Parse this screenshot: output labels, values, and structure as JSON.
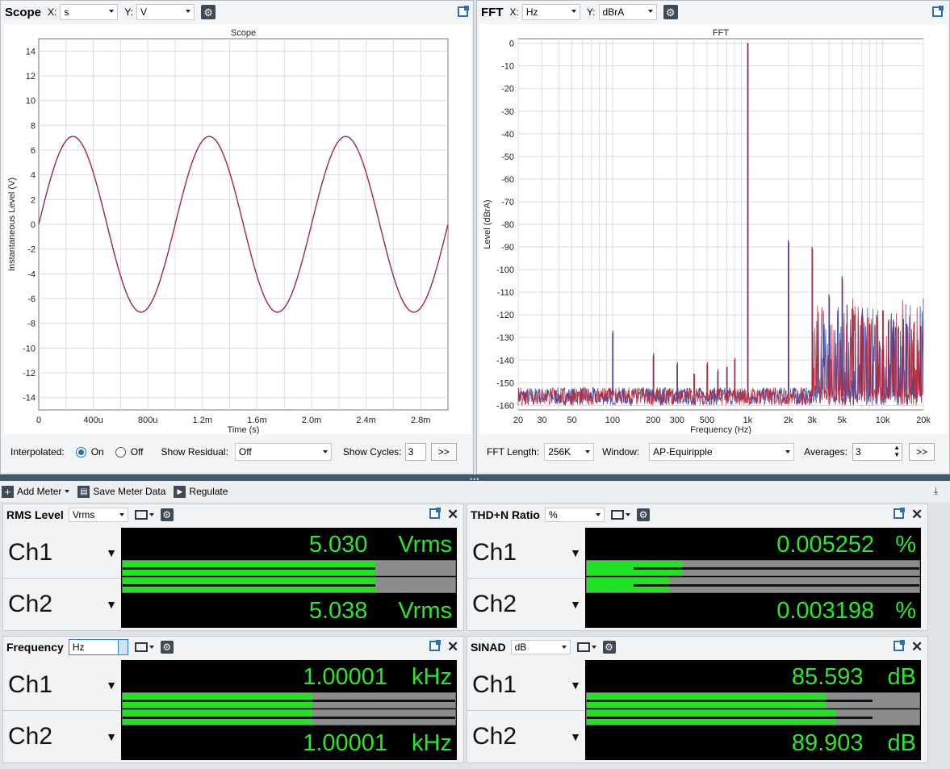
{
  "scope": {
    "title": "Scope",
    "x_label": "X:",
    "x_unit": "s",
    "y_label": "Y:",
    "y_unit": "V",
    "interpolated_label": "Interpolated:",
    "on_label": "On",
    "off_label": "Off",
    "show_residual_label": "Show Residual:",
    "show_residual_value": "Off",
    "show_cycles_label": "Show Cycles:",
    "show_cycles_value": "3",
    "more_button": ">>"
  },
  "fft": {
    "title": "FFT",
    "x_label": "X:",
    "x_unit": "Hz",
    "y_label": "Y:",
    "y_unit": "dBrA",
    "fft_length_label": "FFT Length:",
    "fft_length_value": "256K",
    "window_label": "Window:",
    "window_value": "AP-Equiripple",
    "averages_label": "Averages:",
    "averages_value": "3",
    "more_button": ">>"
  },
  "chart_data": [
    {
      "type": "line",
      "title": "Scope",
      "xlabel": "Time (s)",
      "ylabel": "Instantaneous Level (V)",
      "xlim": [
        0,
        0.003
      ],
      "ylim": [
        -15,
        15
      ],
      "x_ticks": [
        "0",
        "400u",
        "800u",
        "1.2m",
        "1.6m",
        "2.0m",
        "2.4m",
        "2.8m"
      ],
      "x_tick_values": [
        0,
        0.0004,
        0.0008,
        0.0012,
        0.0016,
        0.002,
        0.0024,
        0.0028
      ],
      "y_ticks": [
        "14",
        "12",
        "10",
        "8",
        "6",
        "4",
        "2",
        "0",
        "-2",
        "-4",
        "-6",
        "-8",
        "-10",
        "-12",
        "-14"
      ],
      "grid": true,
      "series": [
        {
          "color": "#a0283c",
          "waveform": "sine",
          "amplitude": 7.1,
          "frequency_hz": 1000,
          "phase_deg": 0
        }
      ]
    },
    {
      "type": "line",
      "title": "FFT",
      "xlabel": "Frequency (Hz)",
      "ylabel": "Level (dBrA)",
      "xscale": "log",
      "xlim": [
        20,
        20000
      ],
      "ylim": [
        -162,
        2
      ],
      "x_ticks": [
        "20",
        "30",
        "50",
        "100",
        "200",
        "300",
        "500",
        "1k",
        "2k",
        "3k",
        "5k",
        "10k",
        "20k"
      ],
      "x_tick_values": [
        20,
        30,
        50,
        100,
        200,
        300,
        500,
        1000,
        2000,
        3000,
        5000,
        10000,
        20000
      ],
      "y_ticks": [
        "0",
        "-10",
        "-20",
        "-30",
        "-40",
        "-50",
        "-60",
        "-70",
        "-80",
        "-90",
        "-100",
        "-110",
        "-120",
        "-130",
        "-140",
        "-150",
        "-160"
      ],
      "grid": true,
      "noise_floor_db": -156,
      "series": [
        {
          "color": "#2a3f9e",
          "peaks": [
            [
              100,
              -128
            ],
            [
              200,
              -138
            ],
            [
              300,
              -142
            ],
            [
              400,
              -146
            ],
            [
              500,
              -142
            ],
            [
              600,
              -145
            ],
            [
              700,
              -143
            ],
            [
              800,
              -140
            ],
            [
              1000,
              0
            ],
            [
              2000,
              -87
            ],
            [
              3000,
              -90
            ],
            [
              4000,
              -111
            ],
            [
              5000,
              -103
            ],
            [
              6000,
              -117
            ],
            [
              7000,
              -120
            ],
            [
              8000,
              -124
            ],
            [
              9000,
              -120
            ],
            [
              10000,
              -118
            ],
            [
              11000,
              -123
            ],
            [
              12000,
              -122
            ],
            [
              13000,
              -126
            ],
            [
              15000,
              -124
            ],
            [
              17000,
              -124
            ],
            [
              19000,
              -125
            ]
          ]
        },
        {
          "color": "#b8283a",
          "peaks": [
            [
              100,
              -127
            ],
            [
              200,
              -137
            ],
            [
              300,
              -141
            ],
            [
              400,
              -146
            ],
            [
              500,
              -141
            ],
            [
              600,
              -144
            ],
            [
              700,
              -143
            ],
            [
              800,
              -139
            ],
            [
              1000,
              0
            ],
            [
              2000,
              -88
            ],
            [
              3000,
              -91
            ],
            [
              4000,
              -112
            ],
            [
              5000,
              -104
            ],
            [
              6000,
              -118
            ],
            [
              7000,
              -120
            ],
            [
              8000,
              -124
            ],
            [
              9000,
              -121
            ],
            [
              10000,
              -118
            ],
            [
              11000,
              -122
            ],
            [
              12000,
              -123
            ],
            [
              13000,
              -125
            ],
            [
              15000,
              -124
            ],
            [
              17000,
              -123
            ],
            [
              19000,
              -125
            ]
          ]
        }
      ]
    }
  ],
  "toolbar": {
    "add_meter": "Add Meter",
    "save_meter_data": "Save Meter Data",
    "regulate": "Regulate"
  },
  "meters": {
    "rms": {
      "title": "RMS Level",
      "unit_select": "Vrms",
      "ch1_label": "Ch1",
      "ch2_label": "Ch2",
      "ch1_value": "5.030",
      "ch2_value": "5.038",
      "unit": "Vrms",
      "ch1_bar_fraction": 0.76,
      "ch2_bar_fraction": 0.76,
      "ch1_line_fraction": 0.76,
      "ch2_line_fraction": 0.76
    },
    "thdn": {
      "title": "THD+N Ratio",
      "unit_select": "%",
      "ch1_label": "Ch1",
      "ch2_label": "Ch2",
      "ch1_value": "0.005252",
      "ch2_value": "0.003198",
      "unit": "%",
      "ch1_bar_fraction": 0.29,
      "ch2_bar_fraction": 0.25,
      "ch1_line_fraction": 0.14,
      "ch2_line_fraction": 0.14
    },
    "freq": {
      "title": "Frequency",
      "unit_select": "Hz",
      "ch1_label": "Ch1",
      "ch2_label": "Ch2",
      "ch1_value": "1.00001",
      "ch2_value": "1.00001",
      "unit": "kHz",
      "ch1_bar_fraction": 0.57,
      "ch2_bar_fraction": 0.57,
      "ch1_line_fraction": 1.0,
      "ch2_line_fraction": 1.0
    },
    "sinad": {
      "title": "SINAD",
      "unit_select": "dB",
      "ch1_label": "Ch1",
      "ch2_label": "Ch2",
      "ch1_value": "85.593",
      "ch2_value": "89.903",
      "unit": "dB",
      "ch1_bar_fraction": 0.72,
      "ch2_bar_fraction": 0.75,
      "ch1_line_fraction": 0.86,
      "ch2_line_fraction": 0.86
    }
  }
}
